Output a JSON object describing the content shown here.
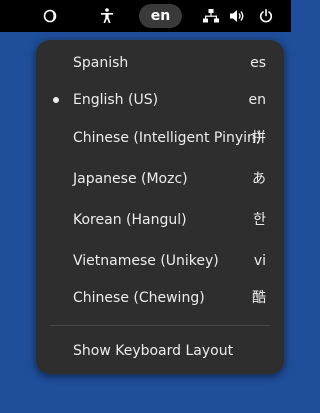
{
  "topbar": {
    "language_indicator": "en",
    "icons": [
      "night-light-icon",
      "accessibility-icon",
      "network-icon",
      "volume-icon",
      "power-icon"
    ]
  },
  "menu": {
    "items": [
      {
        "label": "Spanish",
        "code": "es",
        "selected": false
      },
      {
        "label": "English (US)",
        "code": "en",
        "selected": true
      },
      {
        "label": "Chinese (Intelligent Pinyin)",
        "code": "拼",
        "selected": false
      },
      {
        "label": "Japanese (Mozc)",
        "code": "あ",
        "selected": false
      },
      {
        "label": "Korean (Hangul)",
        "code": "한",
        "selected": false
      },
      {
        "label": "Vietnamese (Unikey)",
        "code": "vi",
        "selected": false
      },
      {
        "label": "Chinese (Chewing)",
        "code": "酷",
        "selected": false
      }
    ],
    "show_keyboard_layout": "Show Keyboard Layout"
  },
  "colors": {
    "desktop_bg": "#1f4e9a",
    "topbar_bg": "#000000",
    "menu_bg": "#2e2e2e",
    "text": "#ececec"
  }
}
